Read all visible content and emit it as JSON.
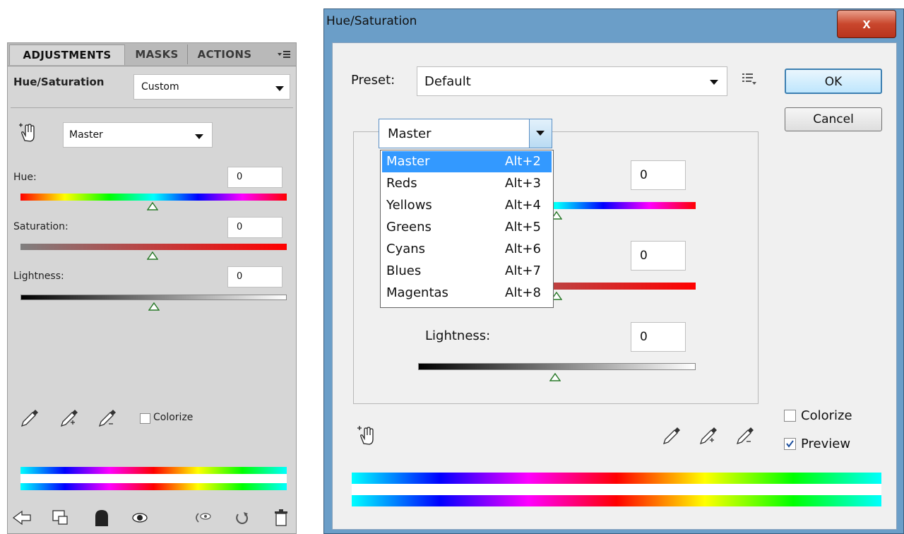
{
  "adjustments_panel": {
    "tabs": [
      "ADJUSTMENTS",
      "MASKS",
      "ACTIONS"
    ],
    "panel_menu_icon": "panel-menu-icon",
    "title": "Hue/Saturation",
    "preset_value": "Custom",
    "channel_value": "Master",
    "hue_label": "Hue:",
    "hue_value": "0",
    "saturation_label": "Saturation:",
    "saturation_value": "0",
    "lightness_label": "Lightness:",
    "lightness_value": "0",
    "colorize_label": "Colorize",
    "colorize_checked": false,
    "bottom_icons": [
      "back-arrow-icon",
      "clip-layer-icon",
      "layer-mask-icon",
      "visibility-eye-icon",
      "view-previous-icon",
      "reset-icon",
      "trash-icon"
    ]
  },
  "dialog": {
    "title": "Hue/Saturation",
    "close_label": "x",
    "preset_label": "Preset:",
    "preset_value": "Default",
    "ok_label": "OK",
    "cancel_label": "Cancel",
    "channel_value": "Master",
    "channel_menu": [
      {
        "label": "Master",
        "shortcut": "Alt+2",
        "highlighted": true
      },
      {
        "label": "Reds",
        "shortcut": "Alt+3"
      },
      {
        "label": "Yellows",
        "shortcut": "Alt+4"
      },
      {
        "label": "Greens",
        "shortcut": "Alt+5"
      },
      {
        "label": "Cyans",
        "shortcut": "Alt+6"
      },
      {
        "label": "Blues",
        "shortcut": "Alt+7"
      },
      {
        "label": "Magentas",
        "shortcut": "Alt+8"
      }
    ],
    "hue_value": "0",
    "saturation_value": "0",
    "lightness_label": "Lightness:",
    "lightness_value": "0",
    "colorize_label": "Colorize",
    "colorize_checked": false,
    "preview_label": "Preview",
    "preview_checked": true
  },
  "colors": {
    "highlight": "#3399ff",
    "panel_bg": "#d6d6d6",
    "dialog_bg": "#f0f0f0",
    "close_button": "#c9472d"
  }
}
